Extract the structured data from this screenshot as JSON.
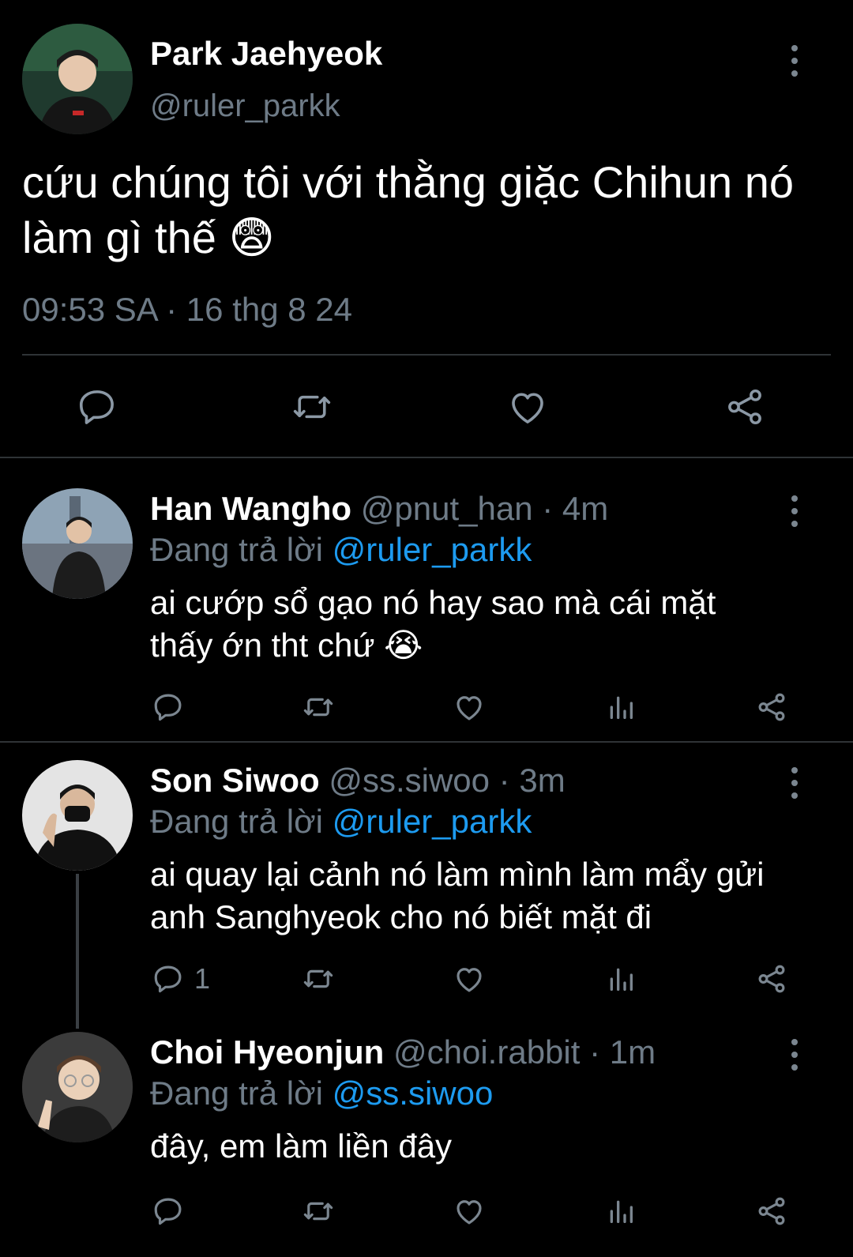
{
  "main_tweet": {
    "name": "Park Jaehyeok",
    "handle": "@ruler_parkk",
    "text_line1": "cứu chúng tôi với thằng giặc Chihun nó",
    "text_line2": "làm gì thế",
    "emoji": "😨",
    "timestamp": "09:53 SA · 16 thg 8 24"
  },
  "replies": [
    {
      "name": "Han Wangho",
      "meta": "@pnut_han · 4m",
      "replying_prefix": "Đang trả lời",
      "replying_to": "@ruler_parkk",
      "text_line1": "ai cướp sổ gạo nó hay sao mà cái mặt",
      "text_line2": "thấy ớn tht chứ",
      "emoji": "😭"
    },
    {
      "name": "Son Siwoo",
      "meta": "@ss.siwoo · 3m",
      "replying_prefix": "Đang trả lời",
      "replying_to": "@ruler_parkk",
      "text_line1": "ai quay lại cảnh nó làm mình làm mẩy gửi",
      "text_line2": "anh Sanghyeok cho nó biết mặt đi",
      "reply_count": "1"
    },
    {
      "name": "Choi Hyeonjun",
      "meta": "@choi.rabbit · 1m",
      "replying_prefix": "Đang trả lời",
      "replying_to": "@ss.siwoo",
      "text_line1": "đây, em làm liền đây"
    }
  ],
  "colors": {
    "background": "#000000",
    "link": "#1d9bf0",
    "muted": "#6e7b87",
    "divider": "#2f3336"
  },
  "icons": [
    "more-vert-icon",
    "reply-icon",
    "retweet-icon",
    "like-icon",
    "share-icon",
    "views-icon"
  ]
}
